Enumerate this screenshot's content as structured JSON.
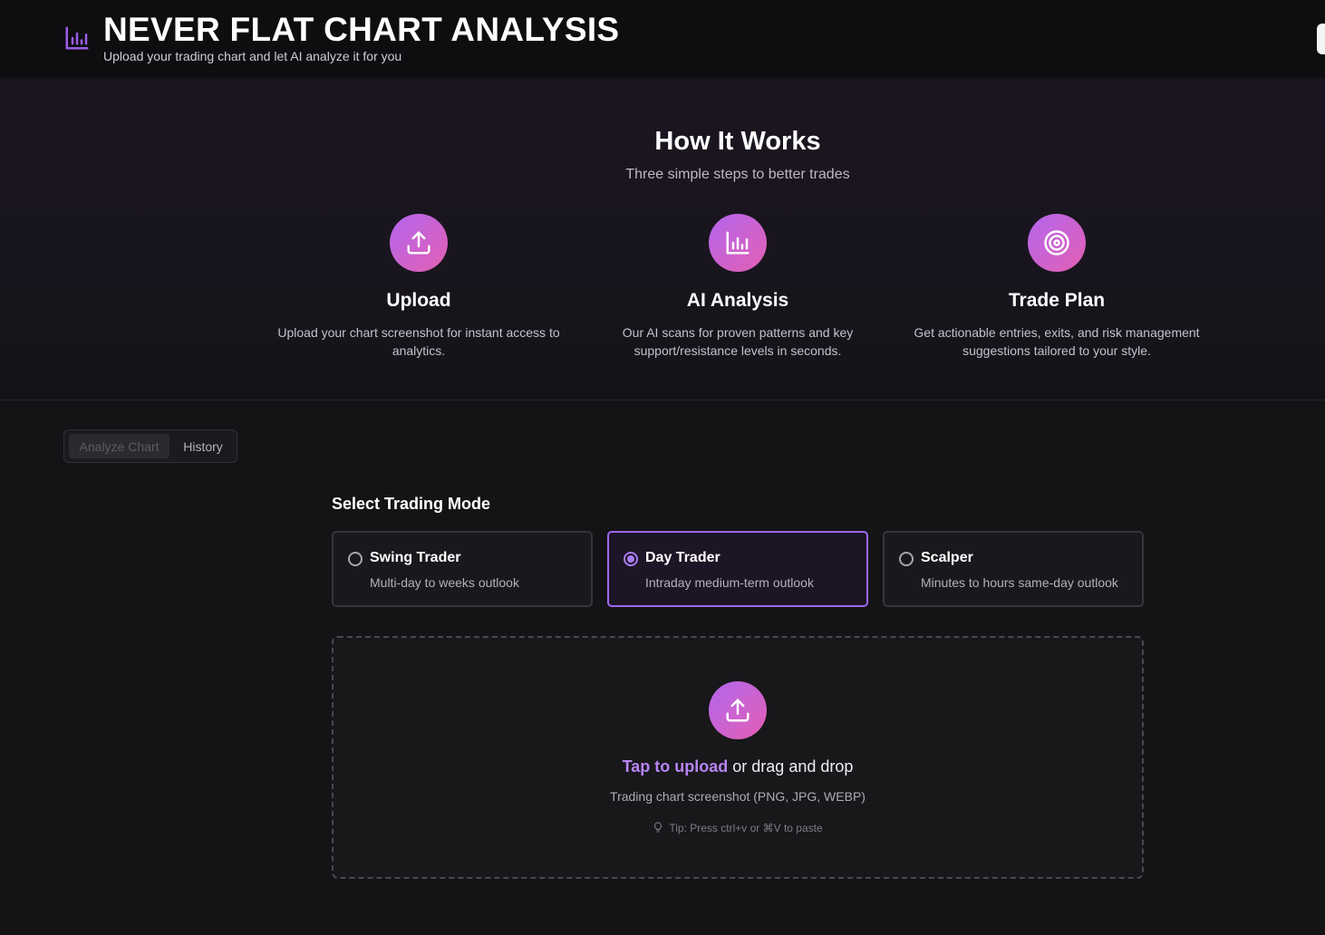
{
  "header": {
    "logo_icon": "bar-chart-icon",
    "title": "NEVER FLAT CHART ANALYSIS",
    "subtitle": "Upload your trading chart and let AI analyze it for you"
  },
  "how_it_works": {
    "title": "How It Works",
    "subtitle": "Three simple steps to better trades",
    "steps": [
      {
        "icon": "upload-icon",
        "title": "Upload",
        "description": "Upload your chart screenshot for instant access to analytics."
      },
      {
        "icon": "bar-chart-icon",
        "title": "AI Analysis",
        "description": "Our AI scans for proven patterns and key support/resistance levels in seconds."
      },
      {
        "icon": "target-icon",
        "title": "Trade Plan",
        "description": "Get actionable entries, exits, and risk management suggestions tailored to your style."
      }
    ]
  },
  "tabs": [
    {
      "label": "Analyze Chart",
      "active": true
    },
    {
      "label": "History",
      "active": false
    }
  ],
  "trading_mode": {
    "heading": "Select Trading Mode",
    "selected": "Day Trader",
    "options": [
      {
        "name": "Swing Trader",
        "description": "Multi-day to weeks outlook"
      },
      {
        "name": "Day Trader",
        "description": "Intraday medium-term outlook"
      },
      {
        "name": "Scalper",
        "description": "Minutes to hours same-day outlook"
      }
    ]
  },
  "upload": {
    "icon": "upload-icon",
    "link_text": "Tap to upload",
    "rest_text": " or drag and drop",
    "formats": "Trading chart screenshot (PNG, JPG, WEBP)",
    "tip_icon": "lightbulb-icon",
    "tip": "Tip: Press ctrl+v or ⌘V to paste"
  },
  "colors": {
    "accent": "#a067ef",
    "gradient_start": "#b366ee",
    "gradient_end": "#e35fb2",
    "background": "#141316"
  }
}
